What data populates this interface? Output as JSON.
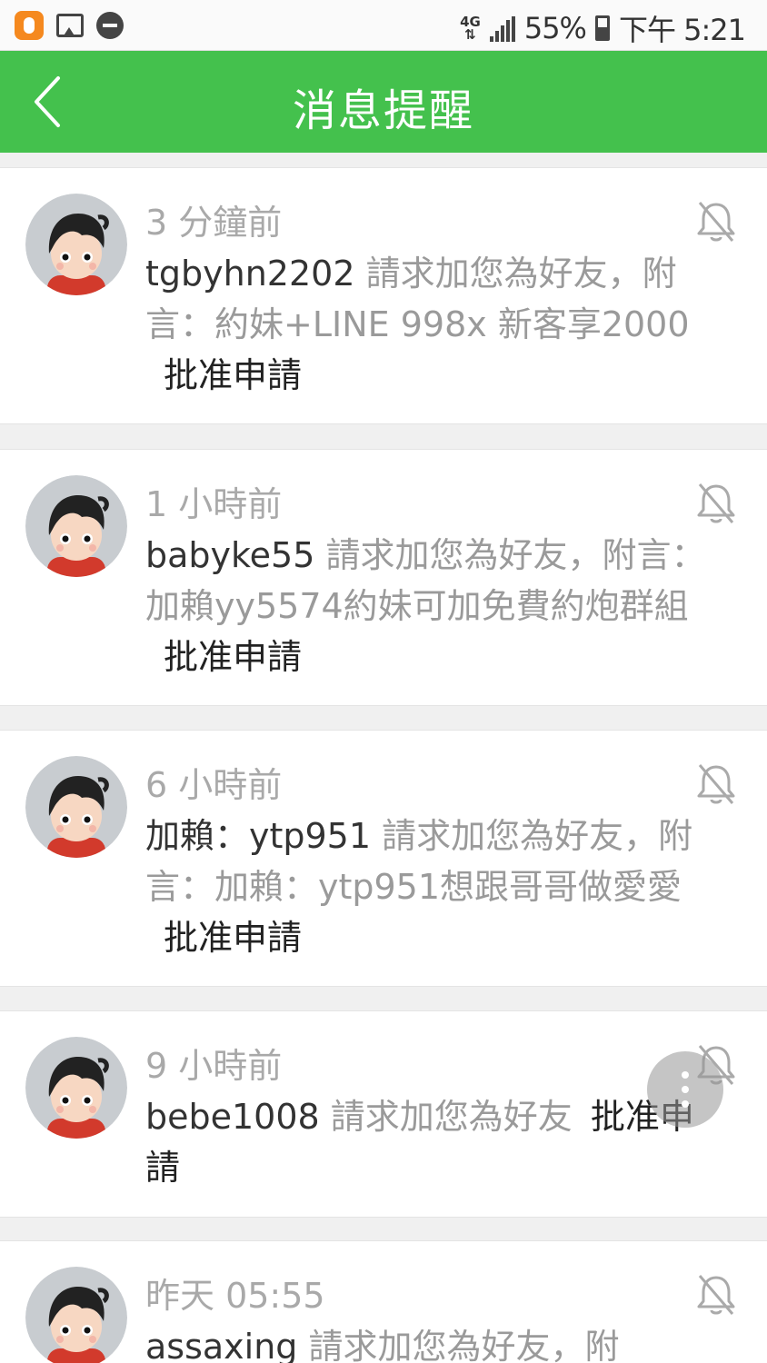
{
  "status_bar": {
    "network": "4G",
    "battery": "55%",
    "time": "下午 5:21",
    "icons": [
      "app-icon",
      "image-icon",
      "do-not-disturb-icon",
      "signal-icon",
      "battery-icon"
    ]
  },
  "header": {
    "title": "消息提醒",
    "back_icon": "chevron-left-icon"
  },
  "colors": {
    "header_bg": "#44c14d",
    "page_bg": "#f0f0f0"
  },
  "notifications": [
    {
      "time": "3 分鐘前",
      "user": "tgbyhn2202",
      "text": " 請求加您為好友，附言：約妹+LINE 998x 新客享2000",
      "action": "批准申請"
    },
    {
      "time": "1 小時前",
      "user": "babyke55",
      "text": " 請求加您為好友，附言：加賴yy5574約妹可加免費約炮群組",
      "action": "批准申請"
    },
    {
      "time": "6 小時前",
      "user": "加賴：ytp951",
      "text": " 請求加您為好友，附言：加賴：ytp951想跟哥哥做愛愛",
      "action": "批准申請"
    },
    {
      "time": "9 小時前",
      "user": "bebe1008",
      "text": " 請求加您為好友",
      "action": "批准申請"
    },
    {
      "time": "昨天 05:55",
      "user": "assaxing",
      "text": " 請求加您為好友，附",
      "action": ""
    }
  ]
}
